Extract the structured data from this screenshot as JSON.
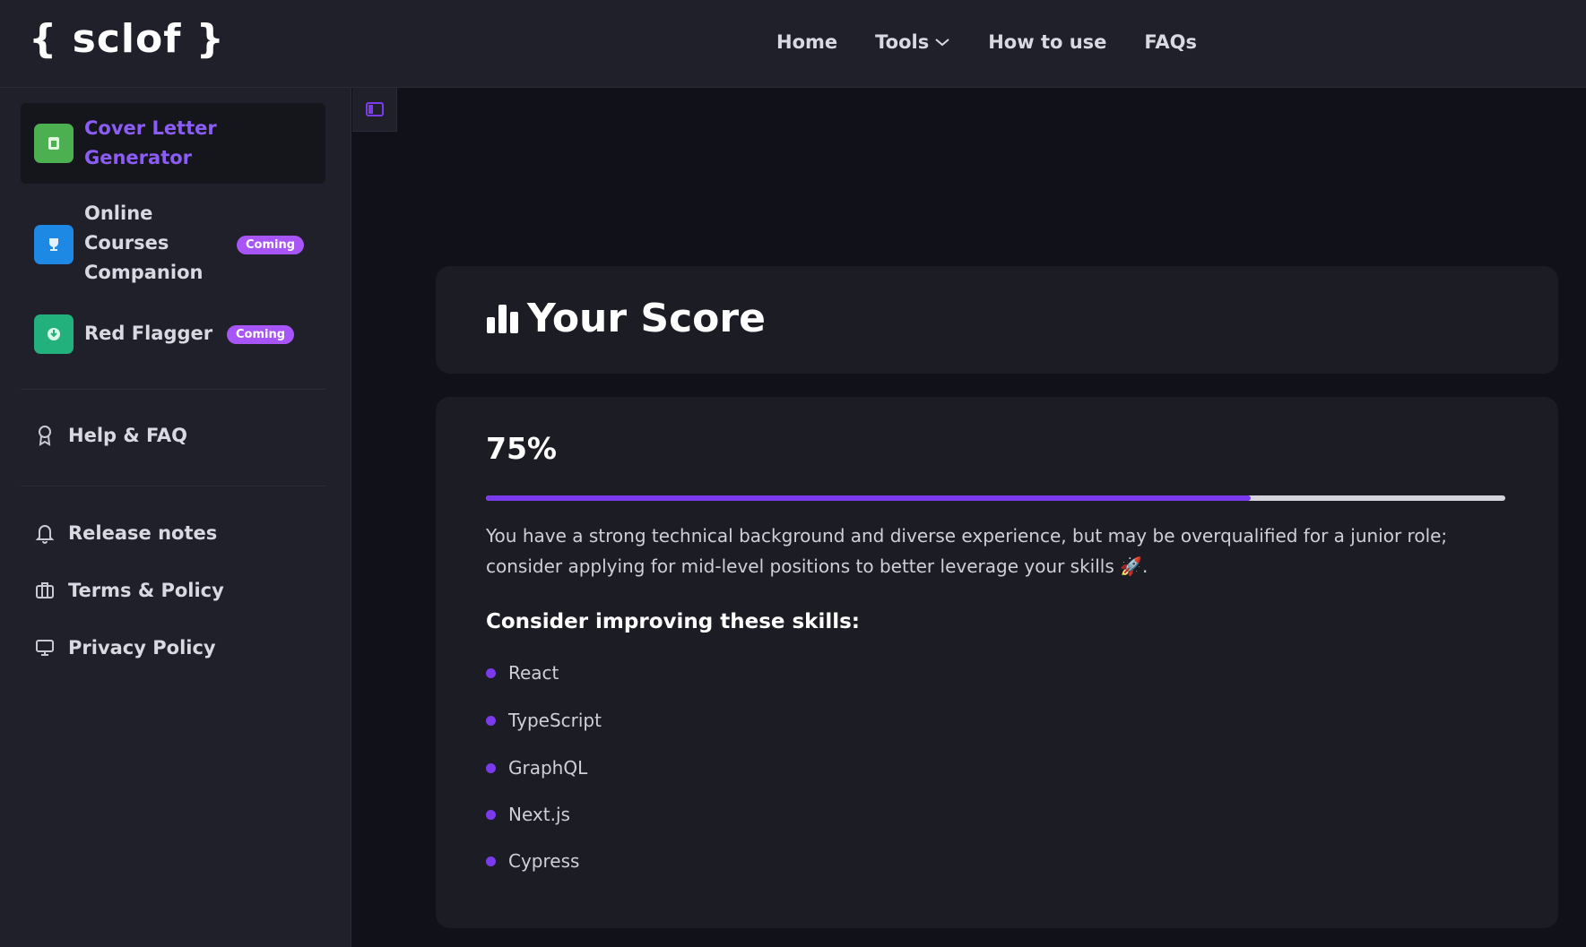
{
  "header": {
    "logo": "{ sclof }",
    "nav": [
      {
        "label": "Home"
      },
      {
        "label": "Tools",
        "has_dropdown": true
      },
      {
        "label": "How to use"
      },
      {
        "label": "FAQs"
      }
    ]
  },
  "sidebar": {
    "tools": [
      {
        "label_line1": "Cover Letter",
        "label_line2": "Generator",
        "icon": "document-icon",
        "icon_color": "#4caf50",
        "active": true
      },
      {
        "label_line1": "Online",
        "label_line2": "Courses",
        "label_line3": "Companion",
        "icon": "trophy-icon",
        "icon_color": "#1e88e5",
        "badge": "Coming"
      },
      {
        "label_line1": "Red Flagger",
        "icon": "shield-check-icon",
        "icon_color": "#22b07d",
        "badge": "Coming"
      }
    ],
    "links": [
      {
        "label": "Help & FAQ",
        "icon": "award-icon"
      },
      {
        "label": "Release notes",
        "icon": "bell-icon"
      },
      {
        "label": "Terms & Policy",
        "icon": "briefcase-icon"
      },
      {
        "label": "Privacy Policy",
        "icon": "monitor-icon"
      }
    ]
  },
  "main": {
    "score_title": "Your Score",
    "score_percent_label": "75%",
    "score_progress": 0.75,
    "summary": "You have a strong technical background and diverse experience, but may be overqualified for a junior role; consider applying for mid-level positions to better leverage your skills 🚀.",
    "skills_heading": "Consider improving these skills:",
    "skills": [
      "React",
      "TypeScript",
      "GraphQL",
      "Next.js",
      "Cypress"
    ]
  },
  "colors": {
    "accent": "#7c3aed",
    "badge": "#a855f7",
    "active_label": "#8b5cf6"
  }
}
